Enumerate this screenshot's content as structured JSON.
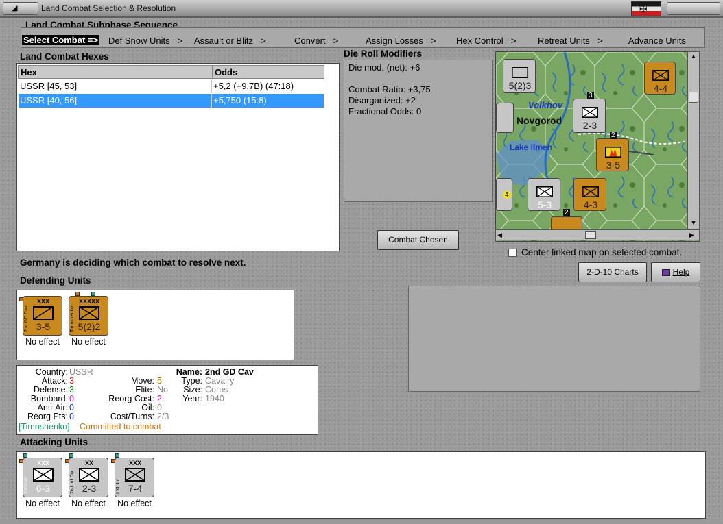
{
  "window": {
    "title": "Land Combat Selection & Resolution"
  },
  "sequence": {
    "title": "Land Combat Subphase Sequence",
    "steps": [
      "Select Combat =>",
      "Def Snow Units =>",
      "Assault or Blitz =>",
      "Convert =>",
      "Assign Losses =>",
      "Hex Control =>",
      "Retreat Units =>",
      "Advance Units"
    ]
  },
  "hexes": {
    "title": "Land Combat Hexes",
    "columns": [
      "Hex",
      "Odds"
    ],
    "rows": [
      {
        "hex": "USSR [45, 53]",
        "odds": "+5,2 (+9,7B) (47:18)"
      },
      {
        "hex": "USSR [40, 56]",
        "odds": "+5,750 (15:8)"
      }
    ]
  },
  "modifiers": {
    "title": "Die Roll Modifiers",
    "lines": [
      "Die mod. (net): +6",
      "",
      "Combat Ratio: +3,75",
      "Disorganized: +2",
      "Fractional Odds: 0"
    ]
  },
  "buttons": {
    "combat_chosen": "Combat Chosen",
    "charts": "2-D-10 Charts",
    "help": "Help"
  },
  "map": {
    "labels": [
      "Volkhov",
      "Novgorod",
      "Lake Ilmen"
    ],
    "units": [
      "5(2)3",
      "4-4",
      "2-3",
      "3-5",
      "5-3",
      "4-3"
    ],
    "stack_badges": [
      "3",
      "2",
      "2",
      "4"
    ]
  },
  "center_map": {
    "label": "Center linked map on selected combat.",
    "checked": false
  },
  "status": "Germany is deciding which combat to resolve next.",
  "defending": {
    "title": "Defending Units",
    "units": [
      {
        "size": "XXX",
        "label": "2nd GD Cav",
        "value": "3-5",
        "effect": "No effect"
      },
      {
        "size": "XXXXX",
        "label": "Timoshenko",
        "value": "5(2)2",
        "effect": "No effect"
      }
    ]
  },
  "unit_info": {
    "country_label": "Country:",
    "country": "USSR",
    "attack_label": "Attack:",
    "attack": "3",
    "defense_label": "Defense:",
    "defense": "3",
    "bombard_label": "Bombard:",
    "bombard": "0",
    "antiair_label": "Anti-Air:",
    "antiair": "0",
    "reorg_pts_label": "Reorg Pts:",
    "reorg_pts": "0",
    "move_label": "Move:",
    "move": "5",
    "elite_label": "Elite:",
    "elite": "No",
    "reorg_cost_label": "Reorg Cost:",
    "reorg_cost": "2",
    "oil_label": "Oil:",
    "oil": "0",
    "cost_turns_label": "Cost/Turns:",
    "cost_turns": "2/3",
    "name_label": "Name:",
    "name": "2nd GD Cav",
    "type_label": "Type:",
    "type": "Cavalry",
    "size_label": "Size:",
    "size": "Corps",
    "year_label": "Year:",
    "year": "1940",
    "leader": "[Timoshenko]",
    "committed": "Committed to combat"
  },
  "attacking": {
    "title": "Attacking Units",
    "units": [
      {
        "size": "XXX",
        "label": "XXVI Inf",
        "value": "6-3",
        "effect": "No effect"
      },
      {
        "size": "XX",
        "label": "2nd Inf Div",
        "value": "2-3",
        "effect": "No effect"
      },
      {
        "size": "XXX",
        "label": "LXII Inf",
        "value": "7-4",
        "effect": "No effect"
      }
    ]
  },
  "colors": {
    "selection": "#3399ff",
    "soviet_unit": "#c88a1e",
    "german_unit": "#c6c6c6",
    "attack": "#d42020",
    "defense": "#1a8a1a",
    "bombard": "#c020c0",
    "antiair": "#2020c0",
    "move": "#a08000",
    "leader": "#1a9a6a",
    "committed": "#d0700a"
  }
}
